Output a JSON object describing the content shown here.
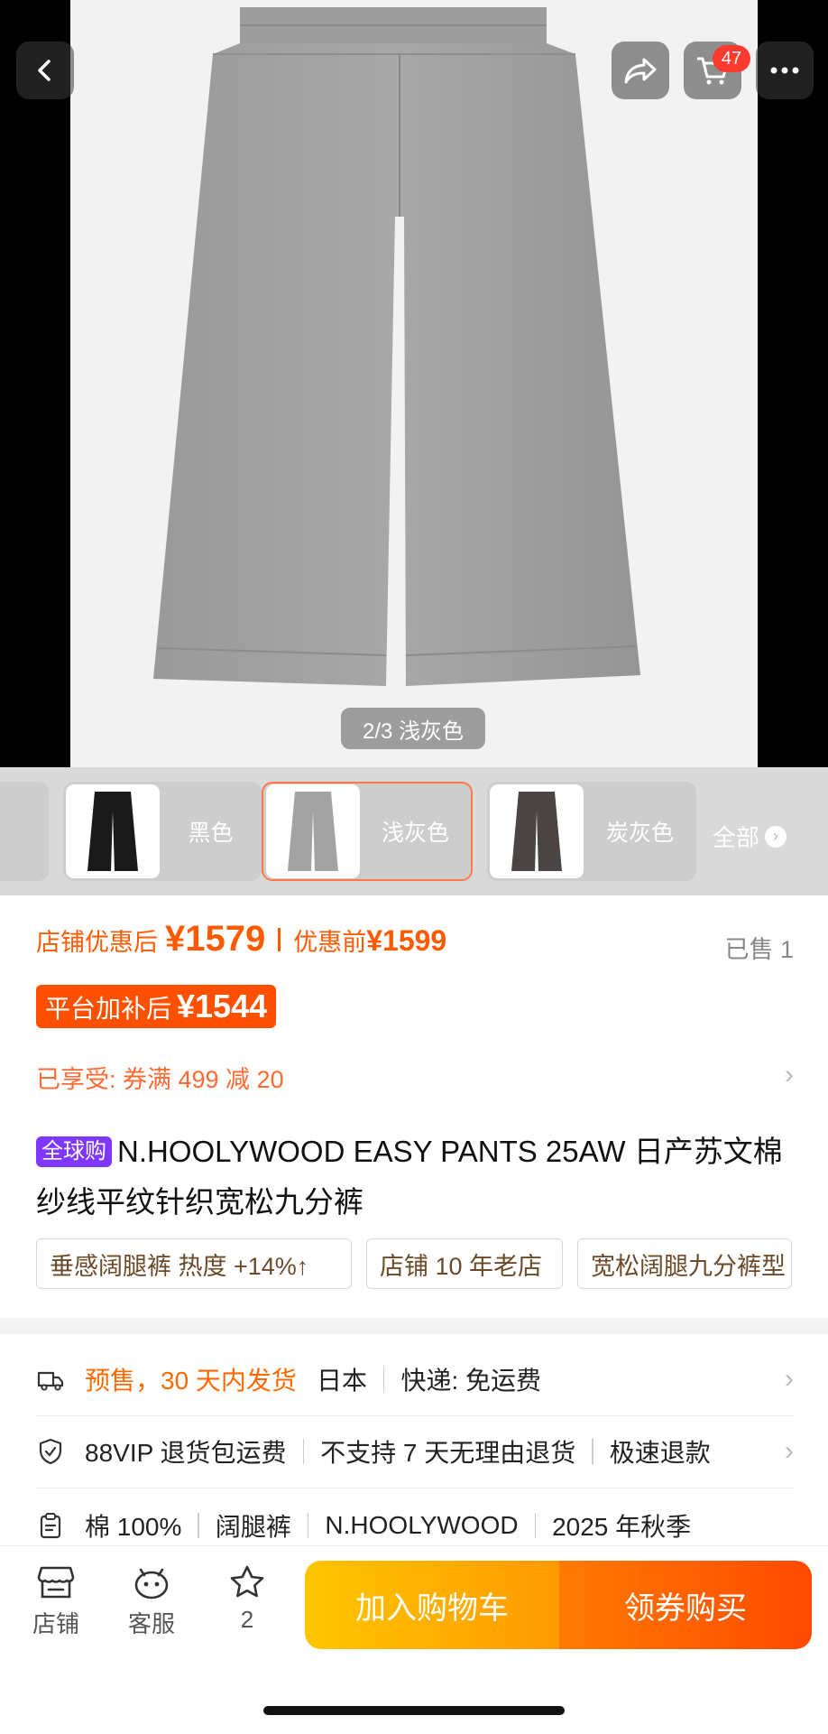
{
  "hero": {
    "photo_counter": "2/3 浅灰色",
    "cart_count": "47",
    "icons": [
      "back-icon",
      "share-icon",
      "cart-icon",
      "more-icon"
    ]
  },
  "colors": {
    "options": [
      {
        "label": "黑色"
      },
      {
        "label": "浅灰色",
        "selected": true
      },
      {
        "label": "炭灰色"
      }
    ],
    "all_label": "全部"
  },
  "price": {
    "shop_label": "店铺优惠后",
    "shop_value": "¥1579",
    "pre_label": "优惠前",
    "pre_value": "¥1599",
    "sold": "已售 1",
    "platform_label": "平台加补后",
    "platform_value": "¥1544",
    "coupon": "已享受: 券满 499 减 20"
  },
  "product": {
    "tag": "全球购",
    "title": "N.HOOLYWOOD EASY PANTS 25AW 日产苏文棉纱线平纹针织宽松九分裤",
    "tags": [
      "垂感阔腿裤 热度 +14%↑",
      "店铺 10 年老店",
      "宽松阔腿九分裤型"
    ]
  },
  "info": {
    "shipping_presale": "预售，30 天内发货",
    "shipping_origin": "日本",
    "shipping_express": "快递: 免运费",
    "return_vip": "88VIP 退货包运费",
    "return_policy": "不支持 7 天无理由退货",
    "return_fast": "极速退款",
    "attrs": [
      "棉 100%",
      "阔腿裤",
      "N.HOOLYWOOD",
      "2025 年秋季"
    ]
  },
  "bottom": {
    "store": "店铺",
    "service": "客服",
    "favorites": "2",
    "add_to_cart": "加入购物车",
    "buy": "领券购买"
  },
  "colors_theme": {
    "accent": "#ff5000",
    "tag_purple": "#7f36ff",
    "cta_yellow": "#ffb300"
  }
}
